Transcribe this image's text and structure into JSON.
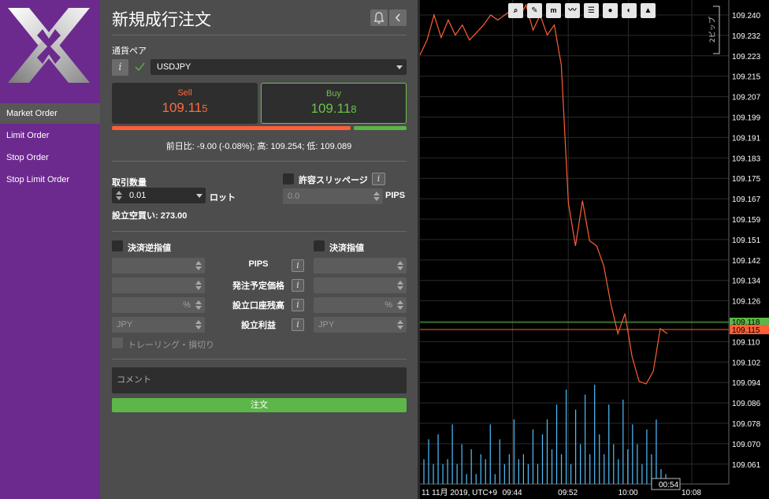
{
  "sidebar": {
    "items": [
      {
        "label": "Market Order",
        "active": true
      },
      {
        "label": "Limit Order",
        "active": false
      },
      {
        "label": "Stop Order",
        "active": false
      },
      {
        "label": "Stop Limit Order",
        "active": false
      }
    ]
  },
  "panel": {
    "title": "新規成行注文",
    "pair_label": "通貨ペア",
    "symbol": "USDJPY",
    "sell": {
      "label": "Sell",
      "price_main": "109.11",
      "price_last": "5"
    },
    "buy": {
      "label": "Buy",
      "price_main": "109.11",
      "price_last": "8"
    },
    "day_range": "前日比: -9.00 (-0.08%); 高: 109.254; 低: 109.089",
    "quantity_label": "取引数量",
    "quantity_value": "0.01",
    "quantity_unit": "ロット",
    "buying_power": "設立空買い: 273.00",
    "slippage_label": "許容スリッページ",
    "slippage_placeholder": "0.0",
    "slippage_unit": "PIPS",
    "stop_loss_label": "決済逆指値",
    "take_profit_label": "決済指値",
    "rows": [
      {
        "label": "PIPS",
        "left_unit": "",
        "right_unit": ""
      },
      {
        "label": "発注予定価格",
        "left_unit": "",
        "right_unit": ""
      },
      {
        "label": "設立口座残高",
        "left_unit": "%",
        "right_unit": "%"
      },
      {
        "label": "設立利益",
        "left_unit": "JPY",
        "right_unit": "JPY"
      }
    ],
    "trailing_label": "トレーリング・損切り",
    "comment_placeholder": "コメント",
    "order_button": "注文"
  },
  "chart_data": {
    "type": "line",
    "y_ticks": [
      "109.240",
      "109.232",
      "109.223",
      "109.215",
      "109.207",
      "109.199",
      "109.191",
      "109.183",
      "109.175",
      "109.167",
      "109.159",
      "109.151",
      "109.142",
      "109.134",
      "109.126",
      "109.118",
      "109.110",
      "109.102",
      "109.094",
      "109.086",
      "109.078",
      "109.070",
      "109.061"
    ],
    "ylim": [
      109.056,
      109.24
    ],
    "x_ticks": [
      {
        "label": "11 11月 2019, UTC+9",
        "t": 0
      },
      {
        "label": "09:44",
        "t": 0.3
      },
      {
        "label": "09:52",
        "t": 0.48
      },
      {
        "label": "10:00",
        "t": 0.675
      },
      {
        "label": "10:08",
        "t": 0.88
      }
    ],
    "scale_label": "2ピップ",
    "bid_label": "109.115",
    "ask_label": "109.118",
    "bid": 109.115,
    "ask": 109.118,
    "time_badge": "00:54",
    "line_series": [
      109.224,
      109.23,
      109.24,
      109.231,
      109.238,
      109.232,
      109.236,
      109.23,
      109.233,
      109.236,
      109.24,
      109.238,
      109.24,
      109.242,
      109.239,
      109.244,
      109.234,
      109.24,
      109.232,
      109.236,
      109.22,
      109.165,
      109.148,
      109.166,
      109.15,
      109.148,
      109.14,
      109.125,
      109.113,
      109.121,
      109.104,
      109.094,
      109.093,
      109.098,
      109.115,
      109.113
    ],
    "volumes": [
      0.25,
      0.45,
      0.2,
      0.5,
      0.2,
      0.25,
      0.6,
      0.2,
      0.4,
      0.1,
      0.35,
      0.1,
      0.3,
      0.25,
      0.6,
      0.1,
      0.45,
      0.2,
      0.3,
      0.65,
      0.25,
      0.3,
      0.2,
      0.55,
      0.2,
      0.5,
      0.65,
      0.35,
      0.8,
      0.3,
      0.95,
      0.2,
      0.75,
      0.4,
      0.9,
      0.3,
      1.0,
      0.5,
      0.3,
      0.8,
      0.4,
      0.25,
      0.85,
      0.35,
      0.6,
      0.4,
      0.2,
      0.55,
      0.3,
      0.65,
      0.15,
      0.1,
      0.02
    ],
    "colors": {
      "line": "#ff5e36",
      "volume": "#4fc1ff",
      "ask": "#5cb547",
      "bid": "#ff5e36"
    }
  }
}
